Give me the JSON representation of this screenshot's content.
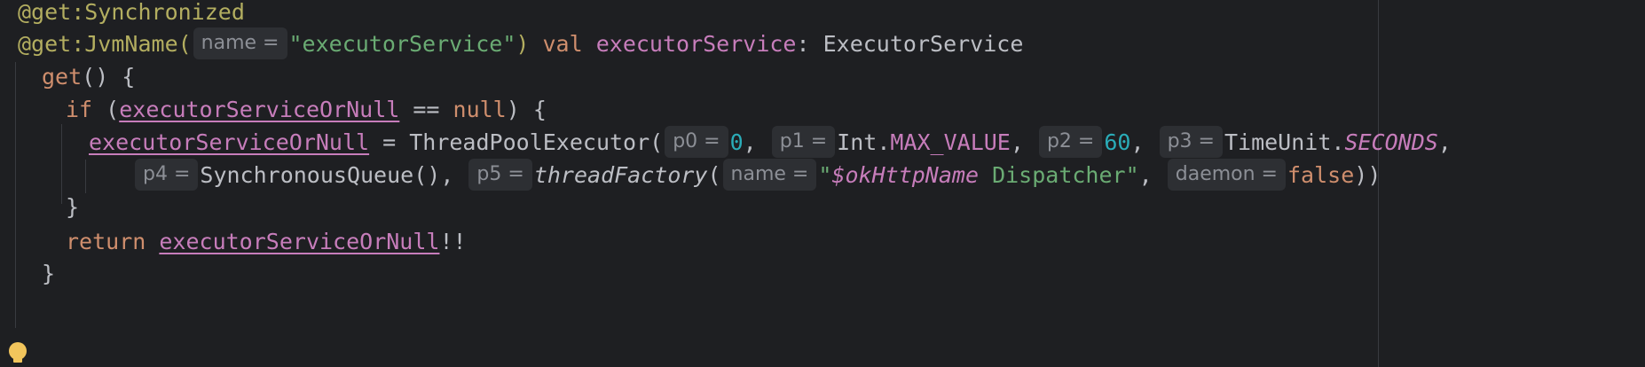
{
  "code": {
    "l1": {
      "annotation": "@get:Synchronized"
    },
    "l2": {
      "annotation": "@get:JvmName(",
      "hint_name": "name =",
      "string": "\"executorService\"",
      "close": ")",
      "kw_val": "val",
      "prop": "executorService",
      "type": ": ExecutorService"
    },
    "l3": {
      "kw_get": "get",
      "rest": "() {"
    },
    "l4": {
      "kw_if": "if",
      "open": "(",
      "var": "executorServiceOrNull",
      "op": " == ",
      "kw_null": "null",
      "close": ") {"
    },
    "l5": {
      "var": "executorServiceOrNull",
      "assign": " = ThreadPoolExecutor(",
      "hint_p0": "p0 =",
      "num0": "0",
      "comma1": ", ",
      "hint_p1": "p1 =",
      "int_cls": "Int.",
      "max_value": "MAX_VALUE",
      "comma2": ", ",
      "hint_p2": "p2 =",
      "num60": "60",
      "comma3": ", ",
      "hint_p3": "p3 =",
      "timeunit": "TimeUnit.",
      "seconds": "SECONDS",
      "comma4": ","
    },
    "l6": {
      "hint_p4": "p4 =",
      "queue": "SynchronousQueue(), ",
      "hint_p5": "p5 =",
      "tf": "threadFactory",
      "open": "(",
      "hint_name": "name =",
      "q1": "\"",
      "tmpl": "$okHttpName",
      "str_rest": " Dispatcher\"",
      "comma": ", ",
      "hint_daemon": "daemon =",
      "kw_false": "false",
      "close": "))"
    },
    "l7": {
      "brace": "}"
    },
    "l8": {
      "kw_return": "return",
      "var": "executorServiceOrNull",
      "bang": "!!"
    },
    "l9": {
      "brace": "}"
    }
  },
  "icons": {
    "bulb": "lightbulb-icon"
  },
  "colors": {
    "background": "#1e1f22",
    "keyword": "#cf8e6d",
    "string": "#6aab73",
    "number": "#2aacb8",
    "property": "#c77dbb",
    "annotation": "#b3ae60",
    "hint_bg": "#2d2f33"
  }
}
